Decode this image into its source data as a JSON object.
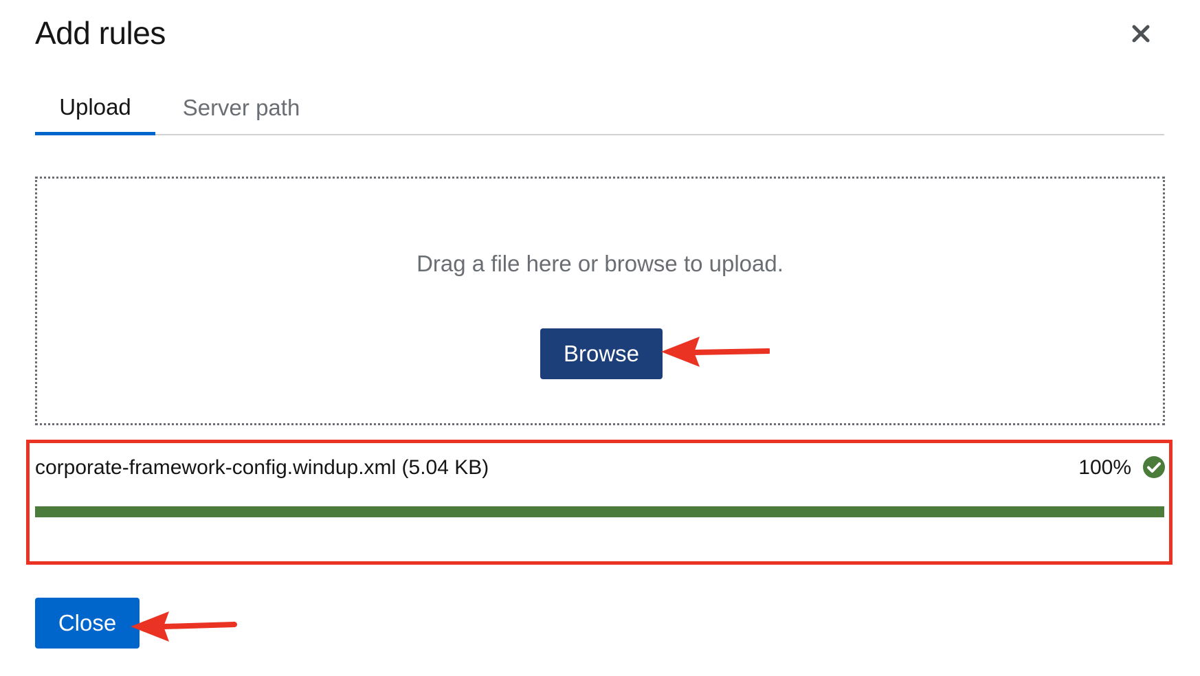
{
  "modal": {
    "title": "Add rules"
  },
  "tabs": [
    {
      "label": "Upload",
      "active": true
    },
    {
      "label": "Server path",
      "active": false
    }
  ],
  "dropzone": {
    "text": "Drag a file here or browse to upload.",
    "browse_label": "Browse"
  },
  "file": {
    "name": "corporate-framework-config.windup.xml (5.04 KB)",
    "percent_label": "100%",
    "progress": 100
  },
  "footer": {
    "close_label": "Close"
  },
  "icons": {
    "close": "close-icon",
    "success": "check-circle-icon",
    "annotation": "arrow-left-icon"
  },
  "colors": {
    "primary": "#0066cc",
    "browse": "#1c3f7a",
    "success": "#4b7c3c",
    "annotation": "#ea3323"
  }
}
